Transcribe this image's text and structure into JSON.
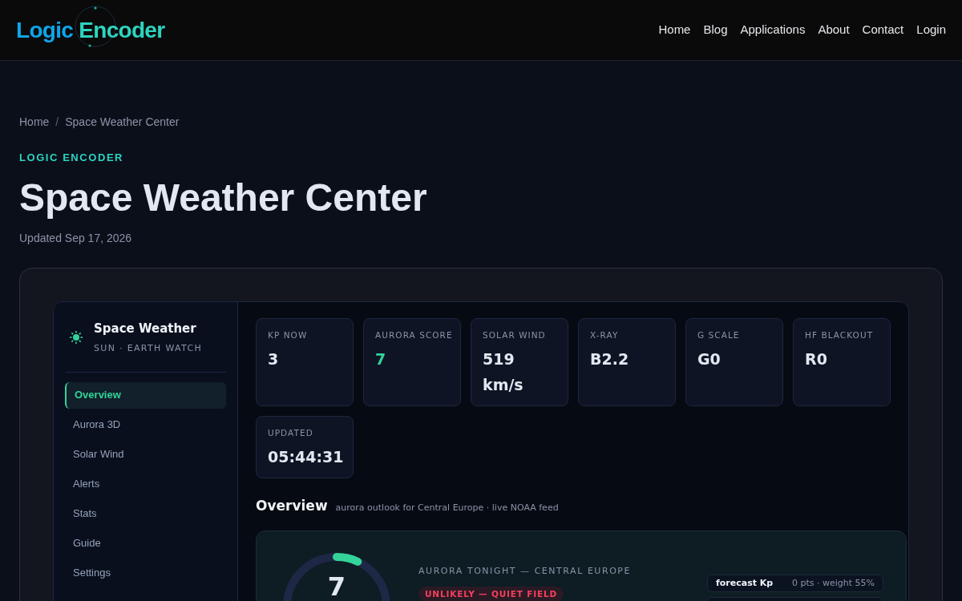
{
  "site": {
    "logo_parts": [
      "Logic",
      "Encoder"
    ],
    "nav": [
      "Home",
      "Blog",
      "Applications",
      "About",
      "Contact",
      "Login"
    ]
  },
  "breadcrumb": [
    "Home",
    "Space Weather Center"
  ],
  "breadcrumb_separator": "/",
  "eyebrow": "LOGIC ENCODER",
  "title": "Space Weather Center",
  "updated": "Updated Sep 17, 2026",
  "app": {
    "brand": {
      "title": "Space Weather",
      "subtitle": "SUN · EARTH WATCH"
    },
    "menu": [
      {
        "label": "Overview",
        "selected": true
      },
      {
        "label": "Aurora 3D",
        "selected": false
      },
      {
        "label": "Solar Wind",
        "selected": false
      },
      {
        "label": "Alerts",
        "selected": false
      },
      {
        "label": "Stats",
        "selected": false
      },
      {
        "label": "Guide",
        "selected": false
      },
      {
        "label": "Settings",
        "selected": false
      }
    ],
    "stats": [
      {
        "label": "KP NOW",
        "value": "3",
        "accent": false
      },
      {
        "label": "AURORA SCORE",
        "value": "7",
        "accent": true
      },
      {
        "label": "SOLAR WIND",
        "value": "519 km/s",
        "accent": false
      },
      {
        "label": "X-RAY",
        "value": "B2.2",
        "accent": false
      },
      {
        "label": "G SCALE",
        "value": "G0",
        "accent": false
      },
      {
        "label": "HF BLACKOUT",
        "value": "R0",
        "accent": false
      },
      {
        "label": "UPDATED",
        "value": "05:44:31",
        "accent": false
      }
    ],
    "section": {
      "title": "Overview",
      "subtitle": "aurora outlook for Central Europe · live NOAA feed"
    },
    "aurora": {
      "score": "7",
      "level": 0.07,
      "label": "AURORA TONIGHT — CENTRAL EUROPE",
      "badge": "UNLIKELY — QUIET FIELD",
      "factors": [
        {
          "name": "forecast Kp",
          "detail": "0 pts · weight 55%"
        }
      ]
    }
  }
}
